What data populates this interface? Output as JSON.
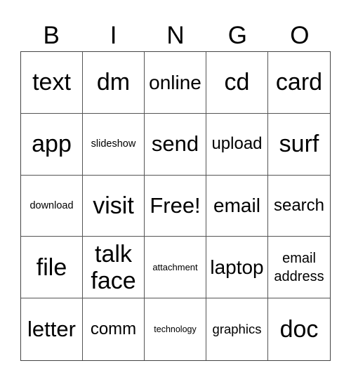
{
  "header": {
    "letters": [
      "B",
      "I",
      "N",
      "G",
      "O"
    ]
  },
  "card": {
    "rows": [
      [
        "text",
        "dm",
        "online",
        "cd",
        "card"
      ],
      [
        "app",
        "slideshow",
        "send",
        "upload",
        "surf"
      ],
      [
        "download",
        "visit",
        "Free!",
        "email",
        "search"
      ],
      [
        "file",
        "talk face",
        "attachment",
        "laptop",
        "email address"
      ],
      [
        "letter",
        "comm",
        "technology",
        "graphics",
        "doc"
      ]
    ],
    "free_space": "Free!"
  }
}
